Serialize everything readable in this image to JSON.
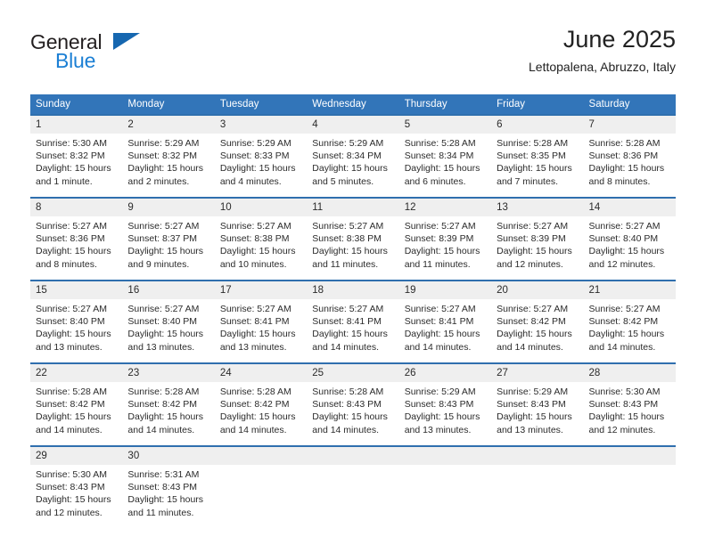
{
  "brand": {
    "word_general": "General",
    "word_blue": "Blue",
    "triangle_color": "#1667b0",
    "blue_color": "#1b7fd4"
  },
  "header": {
    "title": "June 2025",
    "subtitle": "Lettopalena, Abruzzo, Italy"
  },
  "theme": {
    "header_row_bg": "#3275b9",
    "daynum_bg": "#efefef",
    "row_divider": "#2f6fae",
    "text": "#2b2b2b"
  },
  "weekday_headers": [
    "Sunday",
    "Monday",
    "Tuesday",
    "Wednesday",
    "Thursday",
    "Friday",
    "Saturday"
  ],
  "labels": {
    "sunrise_prefix": "Sunrise:",
    "sunset_prefix": "Sunset:",
    "daylight_prefix": "Daylight:"
  },
  "weeks": [
    [
      {
        "day": "1",
        "sunrise": "Sunrise: 5:30 AM",
        "sunset": "Sunset: 8:32 PM",
        "daylight1": "Daylight: 15 hours",
        "daylight2": "and 1 minute."
      },
      {
        "day": "2",
        "sunrise": "Sunrise: 5:29 AM",
        "sunset": "Sunset: 8:32 PM",
        "daylight1": "Daylight: 15 hours",
        "daylight2": "and 2 minutes."
      },
      {
        "day": "3",
        "sunrise": "Sunrise: 5:29 AM",
        "sunset": "Sunset: 8:33 PM",
        "daylight1": "Daylight: 15 hours",
        "daylight2": "and 4 minutes."
      },
      {
        "day": "4",
        "sunrise": "Sunrise: 5:29 AM",
        "sunset": "Sunset: 8:34 PM",
        "daylight1": "Daylight: 15 hours",
        "daylight2": "and 5 minutes."
      },
      {
        "day": "5",
        "sunrise": "Sunrise: 5:28 AM",
        "sunset": "Sunset: 8:34 PM",
        "daylight1": "Daylight: 15 hours",
        "daylight2": "and 6 minutes."
      },
      {
        "day": "6",
        "sunrise": "Sunrise: 5:28 AM",
        "sunset": "Sunset: 8:35 PM",
        "daylight1": "Daylight: 15 hours",
        "daylight2": "and 7 minutes."
      },
      {
        "day": "7",
        "sunrise": "Sunrise: 5:28 AM",
        "sunset": "Sunset: 8:36 PM",
        "daylight1": "Daylight: 15 hours",
        "daylight2": "and 8 minutes."
      }
    ],
    [
      {
        "day": "8",
        "sunrise": "Sunrise: 5:27 AM",
        "sunset": "Sunset: 8:36 PM",
        "daylight1": "Daylight: 15 hours",
        "daylight2": "and 8 minutes."
      },
      {
        "day": "9",
        "sunrise": "Sunrise: 5:27 AM",
        "sunset": "Sunset: 8:37 PM",
        "daylight1": "Daylight: 15 hours",
        "daylight2": "and 9 minutes."
      },
      {
        "day": "10",
        "sunrise": "Sunrise: 5:27 AM",
        "sunset": "Sunset: 8:38 PM",
        "daylight1": "Daylight: 15 hours",
        "daylight2": "and 10 minutes."
      },
      {
        "day": "11",
        "sunrise": "Sunrise: 5:27 AM",
        "sunset": "Sunset: 8:38 PM",
        "daylight1": "Daylight: 15 hours",
        "daylight2": "and 11 minutes."
      },
      {
        "day": "12",
        "sunrise": "Sunrise: 5:27 AM",
        "sunset": "Sunset: 8:39 PM",
        "daylight1": "Daylight: 15 hours",
        "daylight2": "and 11 minutes."
      },
      {
        "day": "13",
        "sunrise": "Sunrise: 5:27 AM",
        "sunset": "Sunset: 8:39 PM",
        "daylight1": "Daylight: 15 hours",
        "daylight2": "and 12 minutes."
      },
      {
        "day": "14",
        "sunrise": "Sunrise: 5:27 AM",
        "sunset": "Sunset: 8:40 PM",
        "daylight1": "Daylight: 15 hours",
        "daylight2": "and 12 minutes."
      }
    ],
    [
      {
        "day": "15",
        "sunrise": "Sunrise: 5:27 AM",
        "sunset": "Sunset: 8:40 PM",
        "daylight1": "Daylight: 15 hours",
        "daylight2": "and 13 minutes."
      },
      {
        "day": "16",
        "sunrise": "Sunrise: 5:27 AM",
        "sunset": "Sunset: 8:40 PM",
        "daylight1": "Daylight: 15 hours",
        "daylight2": "and 13 minutes."
      },
      {
        "day": "17",
        "sunrise": "Sunrise: 5:27 AM",
        "sunset": "Sunset: 8:41 PM",
        "daylight1": "Daylight: 15 hours",
        "daylight2": "and 13 minutes."
      },
      {
        "day": "18",
        "sunrise": "Sunrise: 5:27 AM",
        "sunset": "Sunset: 8:41 PM",
        "daylight1": "Daylight: 15 hours",
        "daylight2": "and 14 minutes."
      },
      {
        "day": "19",
        "sunrise": "Sunrise: 5:27 AM",
        "sunset": "Sunset: 8:41 PM",
        "daylight1": "Daylight: 15 hours",
        "daylight2": "and 14 minutes."
      },
      {
        "day": "20",
        "sunrise": "Sunrise: 5:27 AM",
        "sunset": "Sunset: 8:42 PM",
        "daylight1": "Daylight: 15 hours",
        "daylight2": "and 14 minutes."
      },
      {
        "day": "21",
        "sunrise": "Sunrise: 5:27 AM",
        "sunset": "Sunset: 8:42 PM",
        "daylight1": "Daylight: 15 hours",
        "daylight2": "and 14 minutes."
      }
    ],
    [
      {
        "day": "22",
        "sunrise": "Sunrise: 5:28 AM",
        "sunset": "Sunset: 8:42 PM",
        "daylight1": "Daylight: 15 hours",
        "daylight2": "and 14 minutes."
      },
      {
        "day": "23",
        "sunrise": "Sunrise: 5:28 AM",
        "sunset": "Sunset: 8:42 PM",
        "daylight1": "Daylight: 15 hours",
        "daylight2": "and 14 minutes."
      },
      {
        "day": "24",
        "sunrise": "Sunrise: 5:28 AM",
        "sunset": "Sunset: 8:42 PM",
        "daylight1": "Daylight: 15 hours",
        "daylight2": "and 14 minutes."
      },
      {
        "day": "25",
        "sunrise": "Sunrise: 5:28 AM",
        "sunset": "Sunset: 8:43 PM",
        "daylight1": "Daylight: 15 hours",
        "daylight2": "and 14 minutes."
      },
      {
        "day": "26",
        "sunrise": "Sunrise: 5:29 AM",
        "sunset": "Sunset: 8:43 PM",
        "daylight1": "Daylight: 15 hours",
        "daylight2": "and 13 minutes."
      },
      {
        "day": "27",
        "sunrise": "Sunrise: 5:29 AM",
        "sunset": "Sunset: 8:43 PM",
        "daylight1": "Daylight: 15 hours",
        "daylight2": "and 13 minutes."
      },
      {
        "day": "28",
        "sunrise": "Sunrise: 5:30 AM",
        "sunset": "Sunset: 8:43 PM",
        "daylight1": "Daylight: 15 hours",
        "daylight2": "and 12 minutes."
      }
    ],
    [
      {
        "day": "29",
        "sunrise": "Sunrise: 5:30 AM",
        "sunset": "Sunset: 8:43 PM",
        "daylight1": "Daylight: 15 hours",
        "daylight2": "and 12 minutes."
      },
      {
        "day": "30",
        "sunrise": "Sunrise: 5:31 AM",
        "sunset": "Sunset: 8:43 PM",
        "daylight1": "Daylight: 15 hours",
        "daylight2": "and 11 minutes."
      },
      {
        "day": "",
        "sunrise": "",
        "sunset": "",
        "daylight1": "",
        "daylight2": ""
      },
      {
        "day": "",
        "sunrise": "",
        "sunset": "",
        "daylight1": "",
        "daylight2": ""
      },
      {
        "day": "",
        "sunrise": "",
        "sunset": "",
        "daylight1": "",
        "daylight2": ""
      },
      {
        "day": "",
        "sunrise": "",
        "sunset": "",
        "daylight1": "",
        "daylight2": ""
      },
      {
        "day": "",
        "sunrise": "",
        "sunset": "",
        "daylight1": "",
        "daylight2": ""
      }
    ]
  ]
}
